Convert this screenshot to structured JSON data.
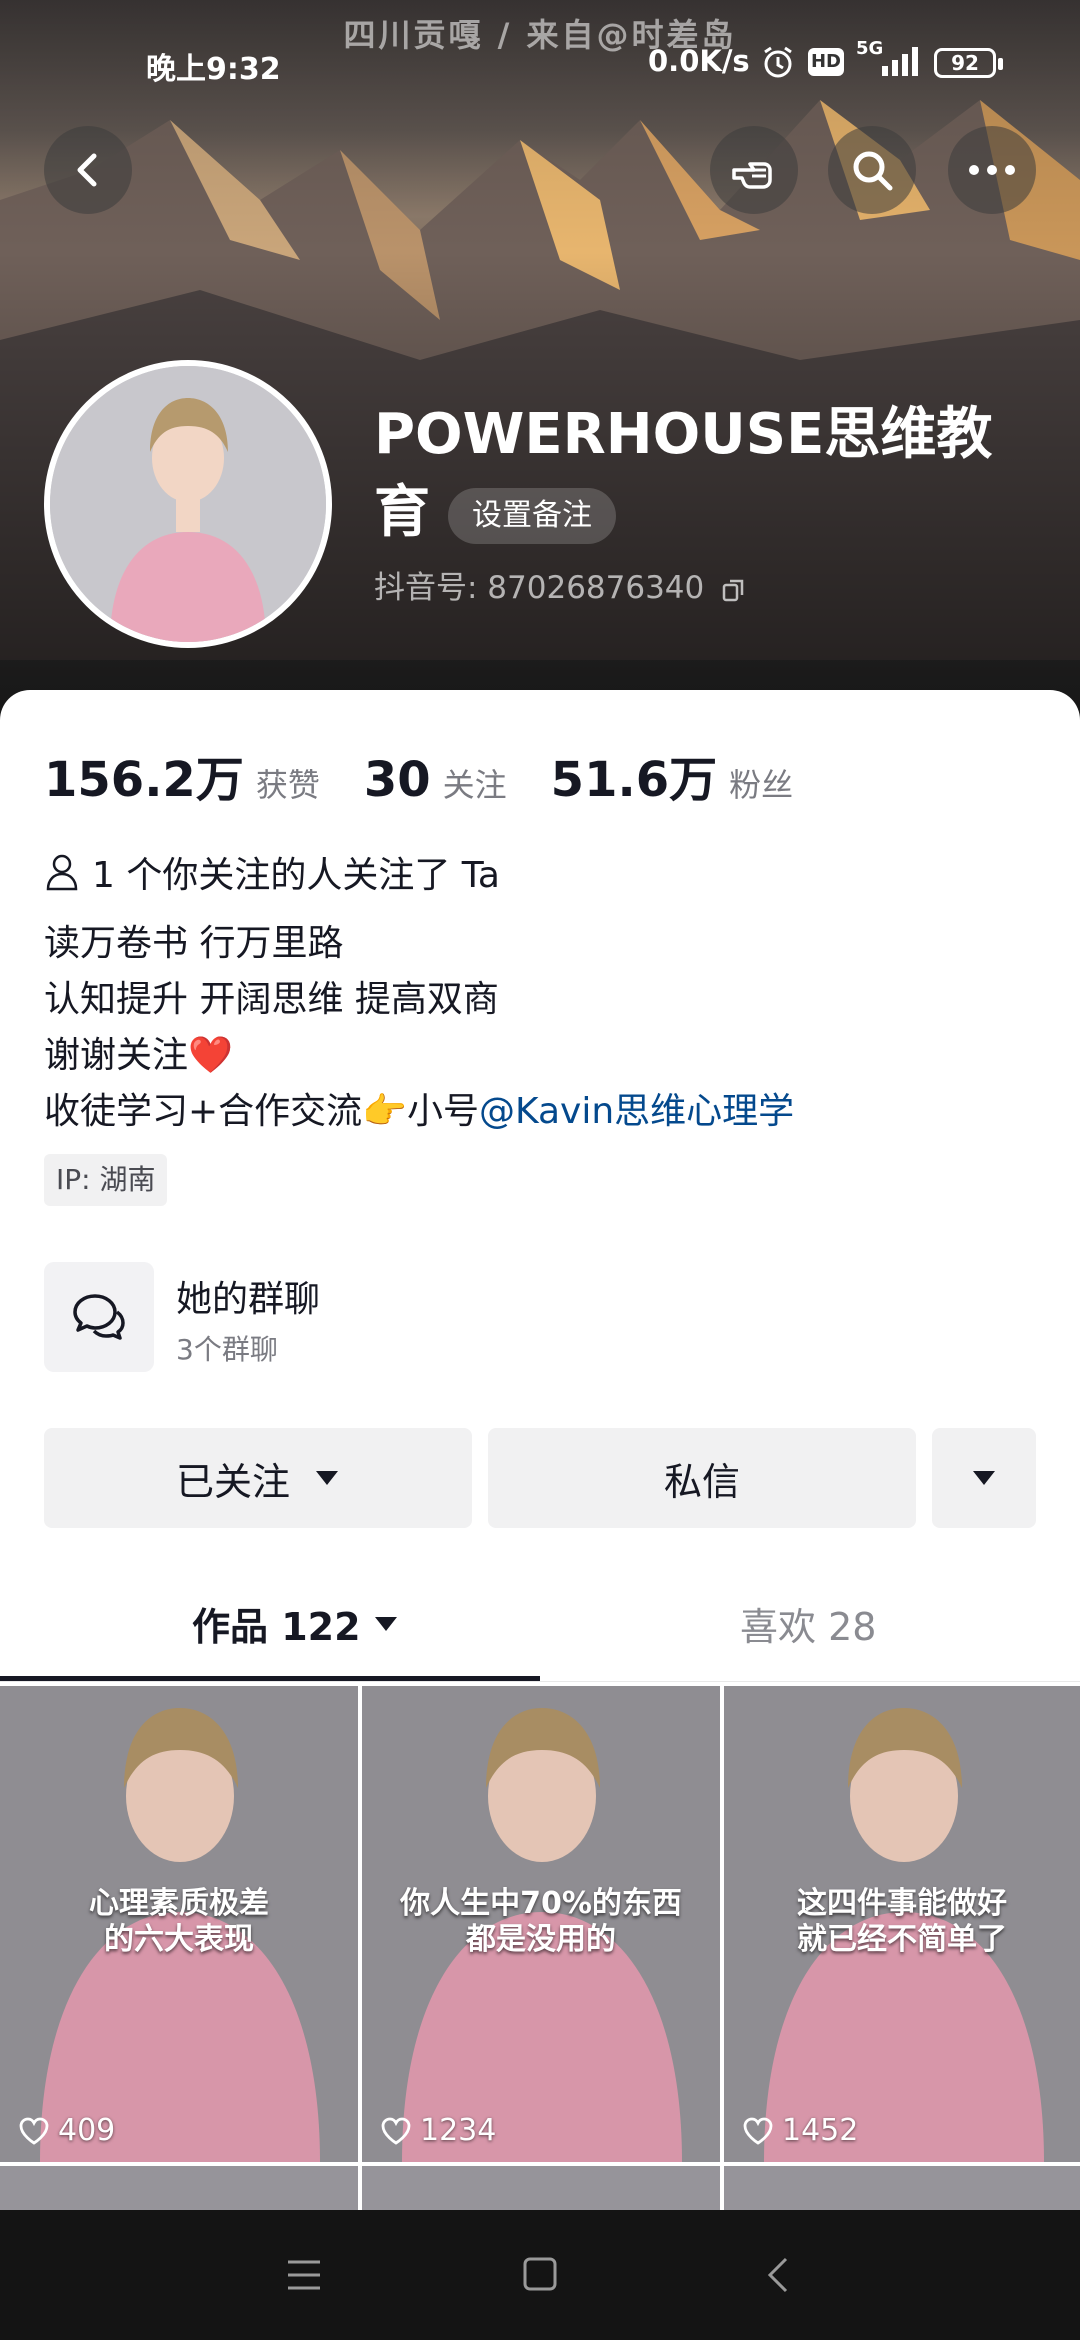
{
  "status_bar": {
    "location_banner": "四川贡嘎 / 来自@时差岛",
    "time": "晚上9:32",
    "net_speed": "0.0K/s",
    "hd": "HD",
    "signal": "5G",
    "battery": "92"
  },
  "profile": {
    "name": "POWERHOUSE思维教育",
    "remark_button": "设置备注",
    "douyin_id": "抖音号: 87026876340"
  },
  "stats": [
    {
      "value": "156.2万",
      "label": "获赞"
    },
    {
      "value": "30",
      "label": "关注"
    },
    {
      "value": "51.6万",
      "label": "粉丝"
    }
  ],
  "bio": {
    "mutual": "1 个你关注的人关注了 Ta",
    "line1": "读万卷书  行万里路",
    "line2": "认知提升  开阔思维  提高双商",
    "line3": "谢谢关注❤️",
    "line4_text": "收徒学习+合作交流👉小号",
    "line4_link": "@Kavin思维心理学",
    "ip": "IP: 湖南"
  },
  "group": {
    "title": "她的群聊",
    "subtitle": "3个群聊"
  },
  "actions": {
    "follow": "已关注",
    "message": "私信"
  },
  "tabs": {
    "works": "作品 122",
    "likes": "喜欢 28"
  },
  "videos": [
    {
      "caption_1": "心理素质极差",
      "caption_2": "的六大表现",
      "likes": "409"
    },
    {
      "caption_1": "你人生中70%的东西",
      "caption_2": "都是没用的",
      "likes": "1234"
    },
    {
      "caption_1": "这四件事能做好",
      "caption_2": "就已经不简单了",
      "likes": "1452"
    }
  ]
}
